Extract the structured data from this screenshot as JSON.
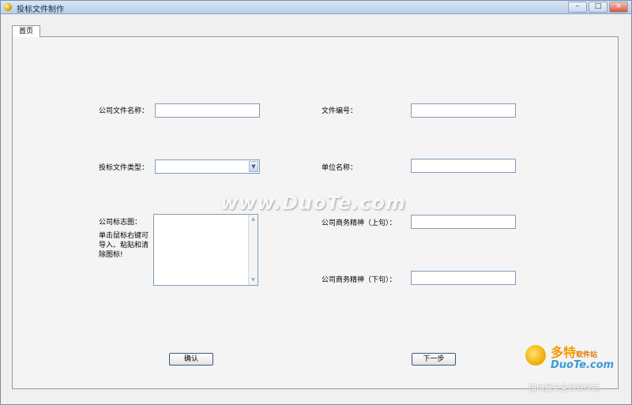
{
  "window": {
    "title": "投标文件制作",
    "minimize": "–",
    "maximize": "□",
    "close": "×"
  },
  "tabs": [
    {
      "label": "首页"
    }
  ],
  "form": {
    "company_file_name": {
      "label": "公司文件名称：",
      "value": ""
    },
    "file_number": {
      "label": "文件编号：",
      "value": ""
    },
    "bid_file_type": {
      "label": "投标文件类型：",
      "value": ""
    },
    "unit_name": {
      "label": "单位名称：",
      "value": ""
    },
    "company_logo": {
      "label": "公司标志图：",
      "hint": "单击鼠标右键可导入、粘贴和清除图标!"
    },
    "spirit_upper": {
      "label": "公司商务精神（上句）：",
      "value": ""
    },
    "spirit_lower": {
      "label": "公司商务精神（下句）：",
      "value": ""
    }
  },
  "buttons": {
    "confirm": "确认",
    "next": "下一步"
  },
  "icons": {
    "scroll_up": "▲",
    "scroll_down": "▼",
    "dropdown": "▼"
  },
  "watermark": {
    "text": "www.DuoTe.com",
    "brand": "多特",
    "brand_suffix": "软件站",
    "site": "DuoTe.com",
    "slogan": "国内最安全的软件站"
  }
}
